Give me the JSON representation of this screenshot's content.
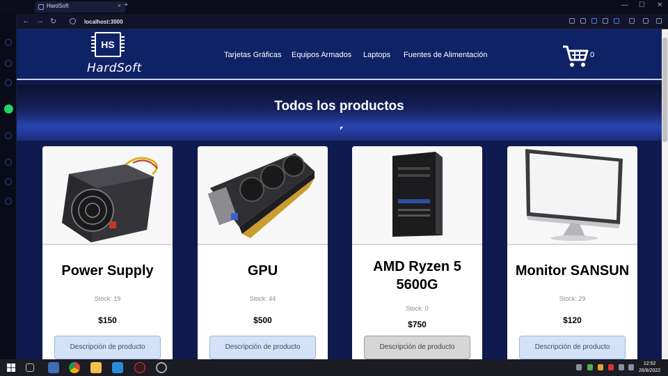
{
  "browser": {
    "tab_title": "HardSoft",
    "tab_close": "×",
    "new_tab": "+",
    "url": "localhost:3000",
    "back": "←",
    "forward": "→",
    "reload": "↻",
    "minimize": "—",
    "maximize": "☐",
    "close": "✕"
  },
  "site": {
    "logo_initials": "HS",
    "brand": "HardSoft",
    "menu": [
      "Tarjetas Gráficas",
      "Equipos Armados",
      "Laptops",
      "Fuentes de Alimentación"
    ],
    "cart_count": "0",
    "hero_title": "Todos los productos"
  },
  "products": [
    {
      "title": "Power Supply",
      "stock": "Stock: 19",
      "price": "$150",
      "button": "Descripción de producto"
    },
    {
      "title": "GPU",
      "stock": "Stock: 44",
      "price": "$500",
      "button": "Descripción de producto"
    },
    {
      "title": "AMD Ryzen 5 5600G",
      "stock": "Stock: 0",
      "price": "$750",
      "button": "Descripción de producto"
    },
    {
      "title": "Monitor SANSUN",
      "stock": "Stock: 29",
      "price": "$120",
      "button": "Descripción de producto"
    }
  ],
  "taskbar": {
    "time": "12:52",
    "date": "26/8/2022"
  },
  "colors": {
    "navbar": "#0f2266",
    "page_bg": "#0f1a4e",
    "button_light": "#d4e2f7",
    "button_dark": "#d6d6d6"
  }
}
